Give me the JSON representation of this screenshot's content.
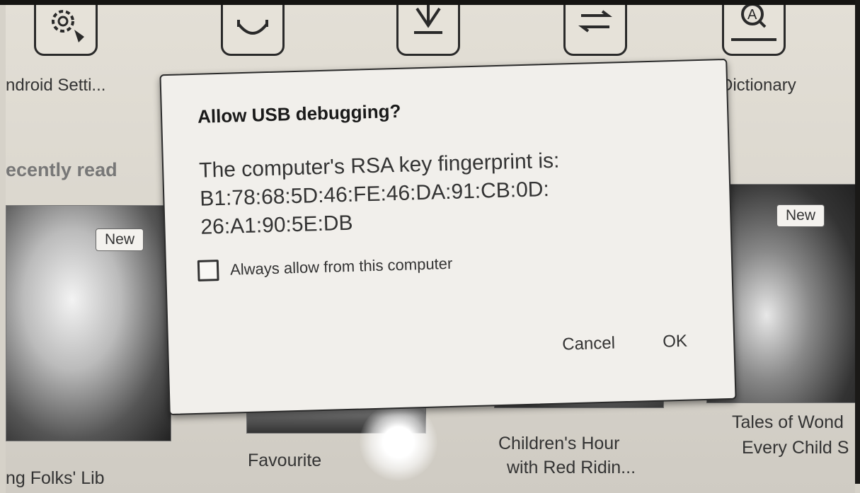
{
  "launcher": {
    "apps": [
      {
        "label": "ndroid Setti...",
        "icon": "settings-gear-icon"
      },
      {
        "label": "",
        "icon": "app-store-bag-icon"
      },
      {
        "label": "",
        "icon": "download-icon"
      },
      {
        "label": "",
        "icon": "transfer-arrows-icon"
      },
      {
        "label": "Dictionary",
        "icon": "dictionary-book-icon"
      }
    ]
  },
  "recent": {
    "title": "ecently read",
    "books": [
      {
        "title": "ng Folks' Lib",
        "badge": "New"
      },
      {
        "title": "Favourite"
      },
      {
        "title_line1": "Children's Hour",
        "title_line2": "with Red Ridin..."
      },
      {
        "title_line1": "Tales of Wond",
        "title_line2": "Every Child S",
        "badge": "New"
      }
    ]
  },
  "dialog": {
    "title": "Allow USB debugging?",
    "message_line1": "The computer's RSA key fingerprint is:",
    "message_line2": "B1:78:68:5D:46:FE:46:DA:91:CB:0D:",
    "message_line3": "26:A1:90:5E:DB",
    "checkbox_label": "Always allow from this computer",
    "checkbox_checked": false,
    "cancel_label": "Cancel",
    "ok_label": "OK"
  }
}
